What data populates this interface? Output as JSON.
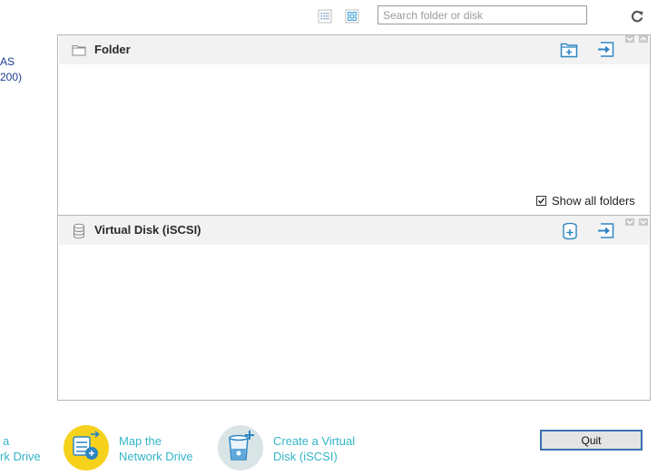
{
  "sidebar": {
    "nas_line1": "AS",
    "nas_line2": "200)"
  },
  "toolbar": {
    "search_placeholder": "Search folder or disk",
    "list_view_icon": "list-view-icon",
    "grid_view_icon": "grid-view-icon",
    "refresh_icon": "refresh-icon"
  },
  "folder_section": {
    "title": "Folder",
    "show_all_label": "Show all folders",
    "show_all_checked": true
  },
  "vdisk_section": {
    "title": "Virtual Disk (iSCSI)"
  },
  "actions": {
    "left_line1": "a",
    "left_line2": "rk Drive",
    "map_line1": "Map the",
    "map_line2": "Network Drive",
    "create_line1": "Create a Virtual",
    "create_line2": "Disk (iSCSI)",
    "quit_label": "Quit"
  },
  "colors": {
    "accent_teal": "#33b5c7",
    "icon_blue": "#2e86c1",
    "map_circle": "#f6d21c",
    "create_circle": "#d9e4e6"
  }
}
